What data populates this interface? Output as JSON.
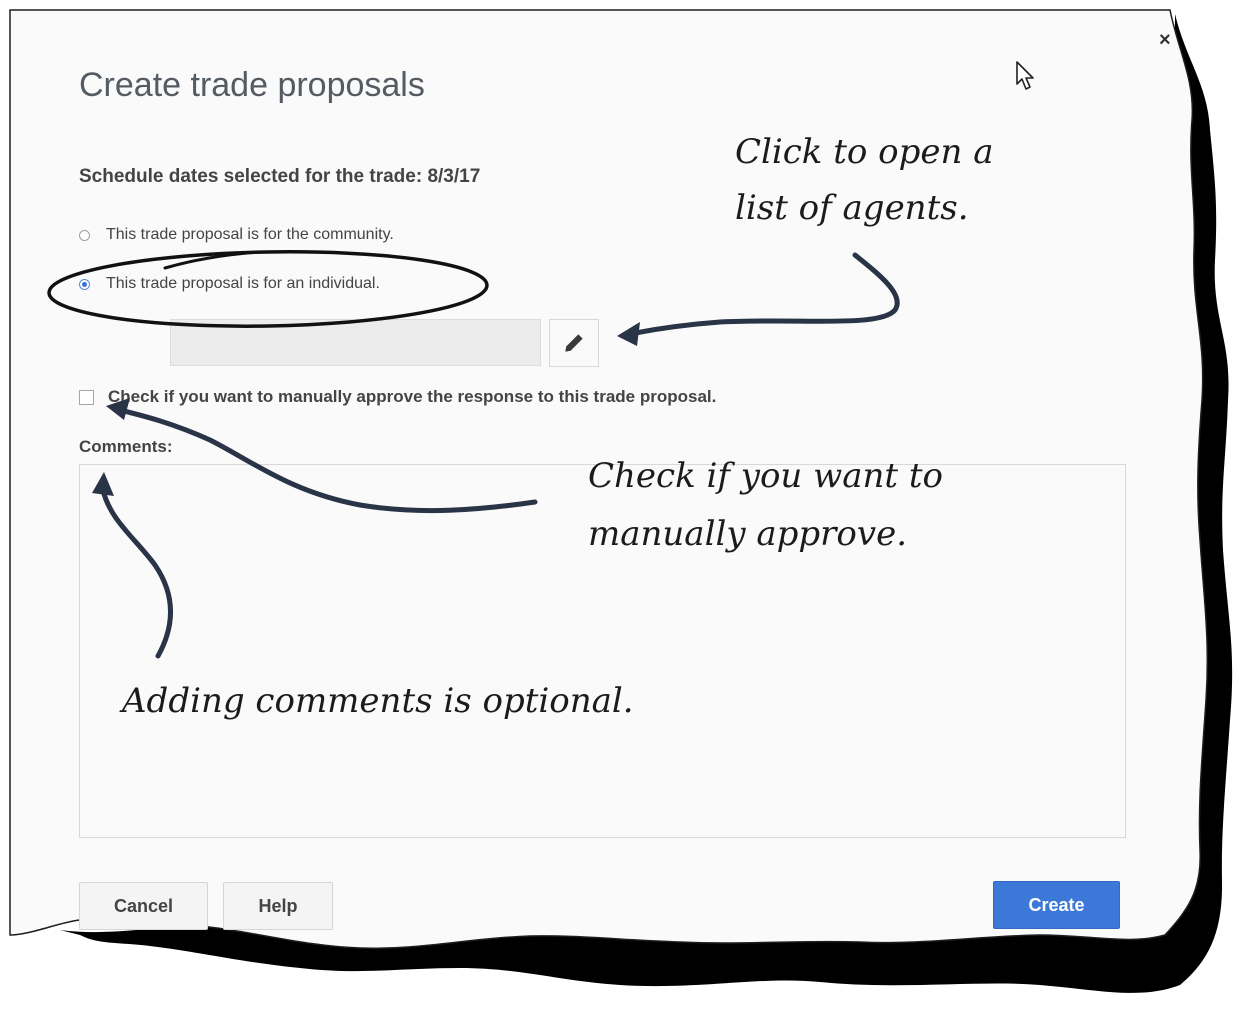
{
  "dialog": {
    "title": "Create trade proposals",
    "close_glyph": "×",
    "schedule_text": "Schedule dates selected for the trade: 8/3/17",
    "radio_community": "This trade proposal is for the community.",
    "radio_individual": "This trade proposal is for an individual.",
    "selected_option": "individual",
    "agent_field_value": "",
    "manual_approve_label": "Check if you want to manually approve the response to this trade proposal.",
    "manual_approve_checked": false,
    "comments_label": "Comments:",
    "comments_value": "",
    "buttons": {
      "cancel": "Cancel",
      "help": "Help",
      "create": "Create"
    }
  },
  "annotations": {
    "agents_line1": "Click to open a",
    "agents_line2": "list of agents.",
    "approve_line1": "Check if you want to",
    "approve_line2": "manually approve.",
    "comments_note": "Adding comments is optional."
  },
  "icons": {
    "close": "close-icon",
    "edit": "pencil-icon",
    "cursor": "mouse-pointer-icon"
  },
  "colors": {
    "primary": "#3b78d8",
    "paper": "#fafafa",
    "shadow": "#000000",
    "annotation_arrow": "#2a3447"
  }
}
